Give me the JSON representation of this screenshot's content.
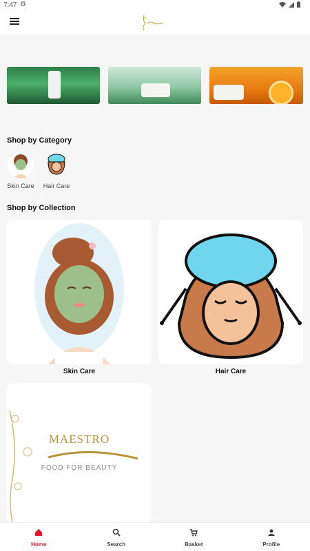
{
  "status": {
    "time": "7:47"
  },
  "sections": {
    "category_title": "Shop by Category",
    "collection_title": "Shop by Collection"
  },
  "categories": [
    {
      "label": "Skin Care"
    },
    {
      "label": "Hair Care"
    }
  ],
  "collections": [
    {
      "label": "Skin Care"
    },
    {
      "label": "Hair Care"
    },
    {
      "label": "",
      "brand": "MAESTRO",
      "tagline": "FOOD FOR BEAUTY"
    }
  ],
  "nav": [
    {
      "label": "Home",
      "icon": "home-icon",
      "active": true
    },
    {
      "label": "Search",
      "icon": "search-icon"
    },
    {
      "label": "Basket",
      "icon": "cart-icon"
    },
    {
      "label": "Profile",
      "icon": "profile-icon"
    }
  ],
  "colors": {
    "accent": "#e8132c",
    "brand_gold": "#b8933a"
  }
}
